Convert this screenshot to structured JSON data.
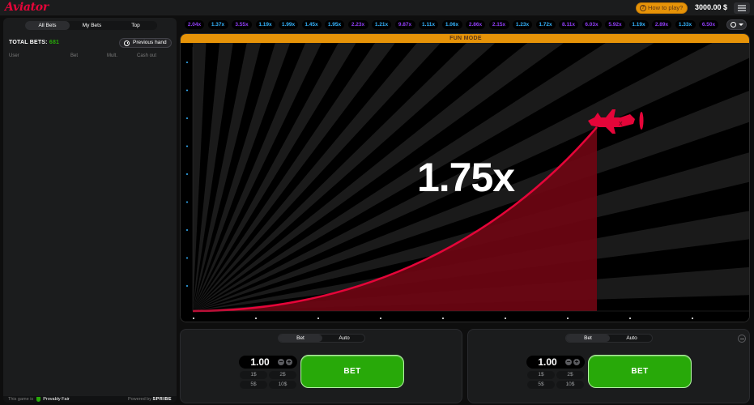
{
  "header": {
    "logo": "Aviator",
    "how_to_play": "How to play?",
    "balance": "3000.00 $"
  },
  "left_panel": {
    "tabs": [
      "All Bets",
      "My Bets",
      "Top"
    ],
    "active_tab": "All Bets",
    "total_bets_label": "TOTAL BETS:",
    "total_bets_count": "681",
    "previous_hand": "Previous hand",
    "columns": [
      "User",
      "Bet",
      "Mult.",
      "Cash out"
    ],
    "footer_text": "This game is",
    "provably_fair": "Provably Fair",
    "powered_by": "Powered by",
    "provider": "SPRIBE"
  },
  "history": [
    {
      "value": "2.04x",
      "color": "purple"
    },
    {
      "value": "1.37x",
      "color": "blue"
    },
    {
      "value": "3.55x",
      "color": "purple"
    },
    {
      "value": "1.19x",
      "color": "blue"
    },
    {
      "value": "1.99x",
      "color": "blue"
    },
    {
      "value": "1.45x",
      "color": "blue"
    },
    {
      "value": "1.95x",
      "color": "blue"
    },
    {
      "value": "2.23x",
      "color": "purple"
    },
    {
      "value": "1.21x",
      "color": "blue"
    },
    {
      "value": "9.87x",
      "color": "purple"
    },
    {
      "value": "1.11x",
      "color": "blue"
    },
    {
      "value": "1.06x",
      "color": "blue"
    },
    {
      "value": "2.86x",
      "color": "purple"
    },
    {
      "value": "2.15x",
      "color": "purple"
    },
    {
      "value": "1.23x",
      "color": "blue"
    },
    {
      "value": "1.72x",
      "color": "blue"
    },
    {
      "value": "8.11x",
      "color": "purple"
    },
    {
      "value": "6.03x",
      "color": "purple"
    },
    {
      "value": "5.92x",
      "color": "purple"
    },
    {
      "value": "1.19x",
      "color": "blue"
    },
    {
      "value": "2.89x",
      "color": "purple"
    },
    {
      "value": "1.33x",
      "color": "blue"
    },
    {
      "value": "6.50x",
      "color": "purple"
    }
  ],
  "game": {
    "mode_banner": "FUN MODE",
    "multiplier": "1.75x"
  },
  "bet_panels": [
    {
      "tabs": [
        "Bet",
        "Auto"
      ],
      "amount": "1.00",
      "chips": [
        "1$",
        "2$",
        "5$",
        "10$"
      ],
      "button": "BET"
    },
    {
      "tabs": [
        "Bet",
        "Auto"
      ],
      "amount": "1.00",
      "chips": [
        "1$",
        "2$",
        "5$",
        "10$"
      ],
      "button": "BET"
    }
  ],
  "colors": {
    "accent_red": "#e50539",
    "bet_green": "#28a909",
    "mode_orange": "#e69308"
  }
}
